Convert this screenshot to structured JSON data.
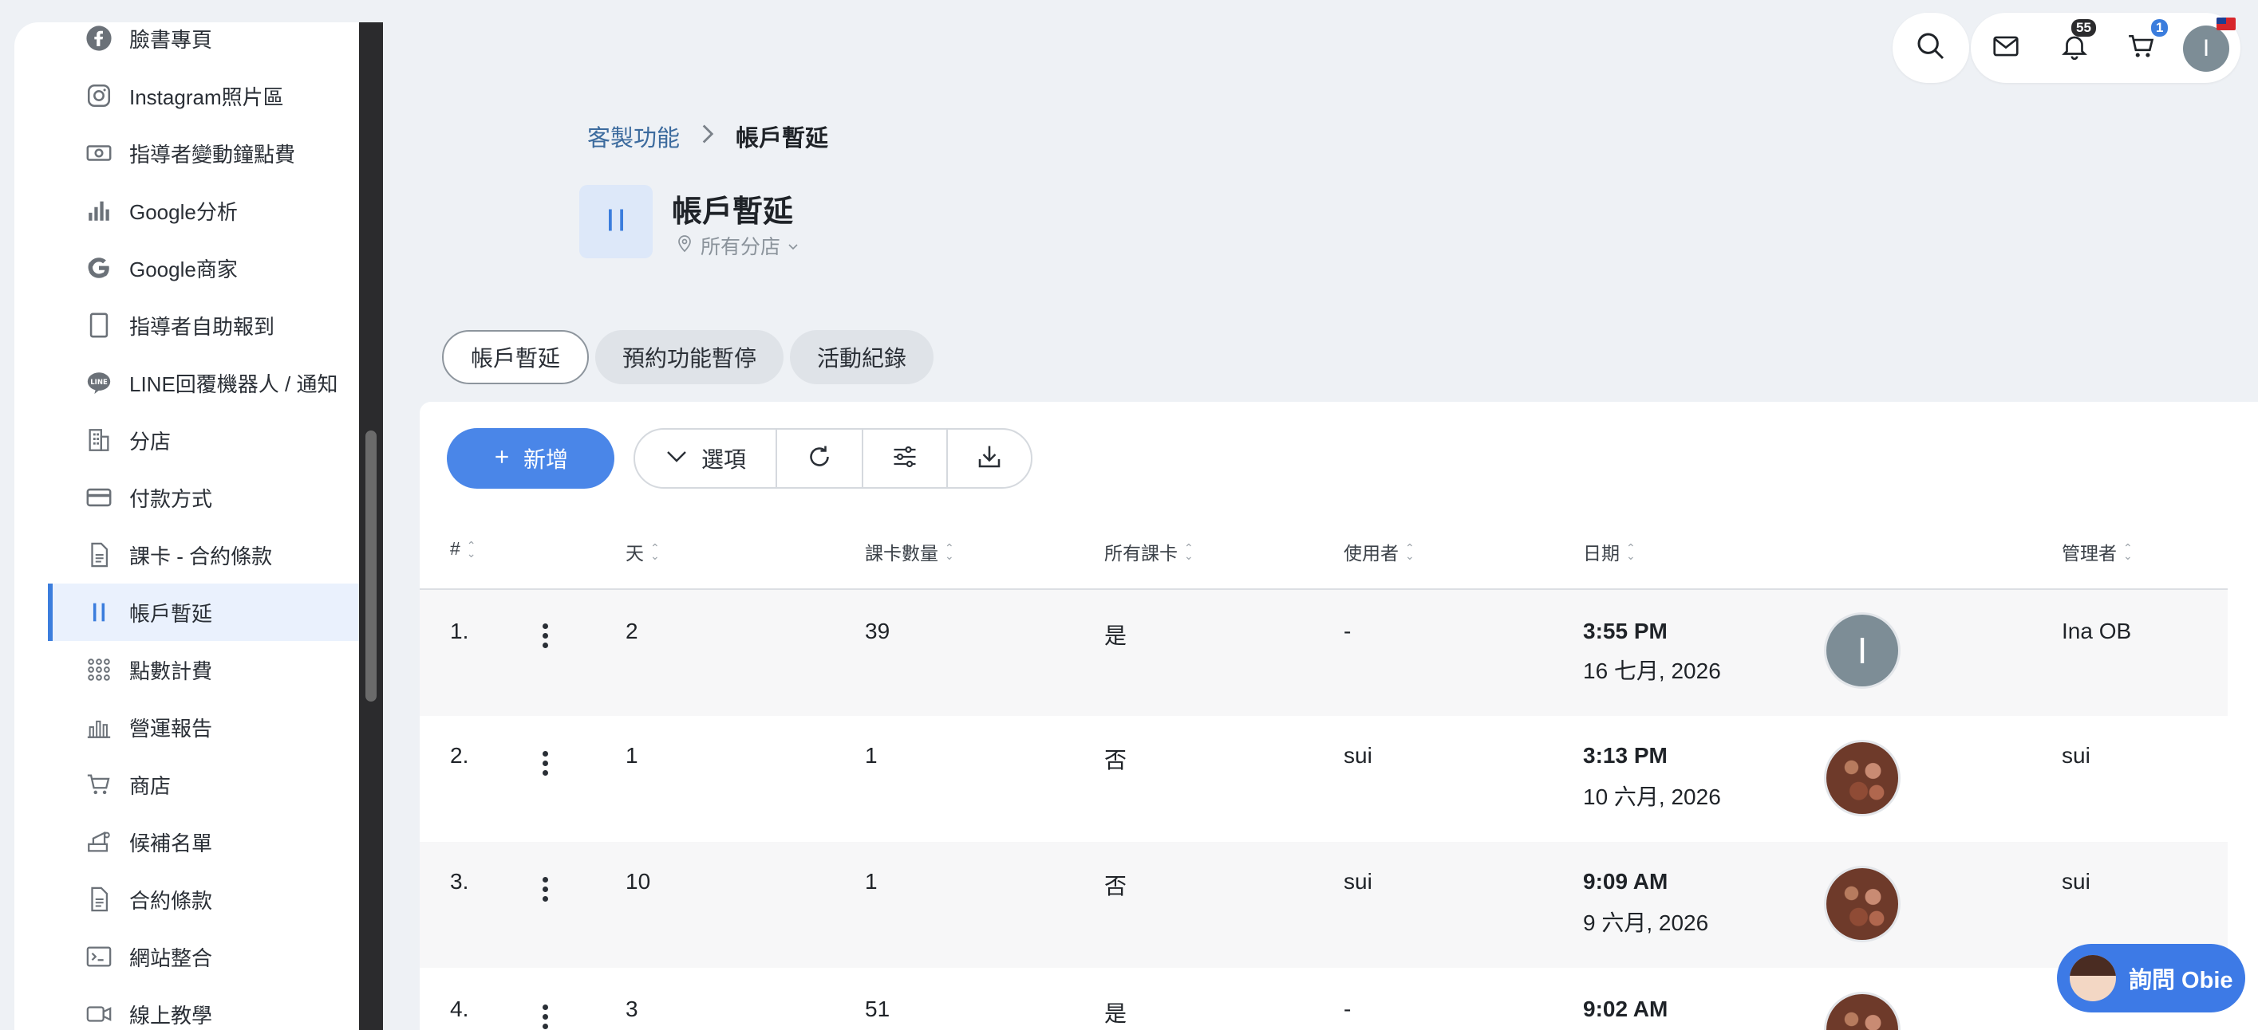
{
  "sidebar": {
    "items": [
      {
        "label": "臉書專頁",
        "icon": "facebook-icon"
      },
      {
        "label": "Instagram照片區",
        "icon": "instagram-icon"
      },
      {
        "label": "指導者變動鐘點費",
        "icon": "money-icon"
      },
      {
        "label": "Google分析",
        "icon": "bar-chart-icon"
      },
      {
        "label": "Google商家",
        "icon": "google-icon"
      },
      {
        "label": "指導者自助報到",
        "icon": "tablet-icon"
      },
      {
        "label": "LINE回覆機器人 / 通知",
        "icon": "line-icon"
      },
      {
        "label": "分店",
        "icon": "building-icon"
      },
      {
        "label": "付款方式",
        "icon": "credit-card-icon"
      },
      {
        "label": "課卡 - 合約條款",
        "icon": "document-icon"
      },
      {
        "label": "帳戶暫延",
        "icon": "pause-icon",
        "active": true
      },
      {
        "label": "點數計費",
        "icon": "grid-dots-icon"
      },
      {
        "label": "營運報告",
        "icon": "report-chart-icon"
      },
      {
        "label": "商店",
        "icon": "cart-icon"
      },
      {
        "label": "候補名單",
        "icon": "waitlist-icon"
      },
      {
        "label": "合約條款",
        "icon": "contract-icon"
      },
      {
        "label": "網站整合",
        "icon": "terminal-icon"
      },
      {
        "label": "線上教學",
        "icon": "video-icon"
      }
    ]
  },
  "topbar": {
    "notification_count": "55",
    "cart_count": "1",
    "avatar_letter": "I"
  },
  "breadcrumb": {
    "parent": "客製功能",
    "current": "帳戶暫延"
  },
  "header": {
    "title": "帳戶暫延",
    "branch": "所有分店"
  },
  "tabs": [
    {
      "label": "帳戶暫延",
      "active": true
    },
    {
      "label": "預約功能暫停",
      "active": false
    },
    {
      "label": "活動紀錄",
      "active": false
    }
  ],
  "toolbar": {
    "add_label": "新增",
    "options_label": "選項"
  },
  "table": {
    "columns": [
      "#",
      "天",
      "課卡數量",
      "所有課卡",
      "使用者",
      "日期",
      "管理者"
    ],
    "rows": [
      {
        "index": "1.",
        "days": "2",
        "cards": "39",
        "all_cards": "是",
        "user": "-",
        "time": "3:55 PM",
        "date": "16 七月, 2026",
        "avatar": "I",
        "admin": "Ina OB"
      },
      {
        "index": "2.",
        "days": "1",
        "cards": "1",
        "all_cards": "否",
        "user": "sui",
        "time": "3:13 PM",
        "date": "10 六月, 2026",
        "avatar": "",
        "admin": "sui"
      },
      {
        "index": "3.",
        "days": "10",
        "cards": "1",
        "all_cards": "否",
        "user": "sui",
        "time": "9:09 AM",
        "date": "9 六月, 2026",
        "avatar": "",
        "admin": "sui"
      },
      {
        "index": "4.",
        "days": "3",
        "cards": "51",
        "all_cards": "是",
        "user": "-",
        "time": "9:02 AM",
        "date": "",
        "avatar": "",
        "admin": ""
      }
    ]
  },
  "assistant": {
    "label": "詢問 Obie"
  },
  "colors": {
    "accent": "#4a86e8",
    "active_bg": "#eaf1fd",
    "page_bg": "#eef1f5"
  }
}
